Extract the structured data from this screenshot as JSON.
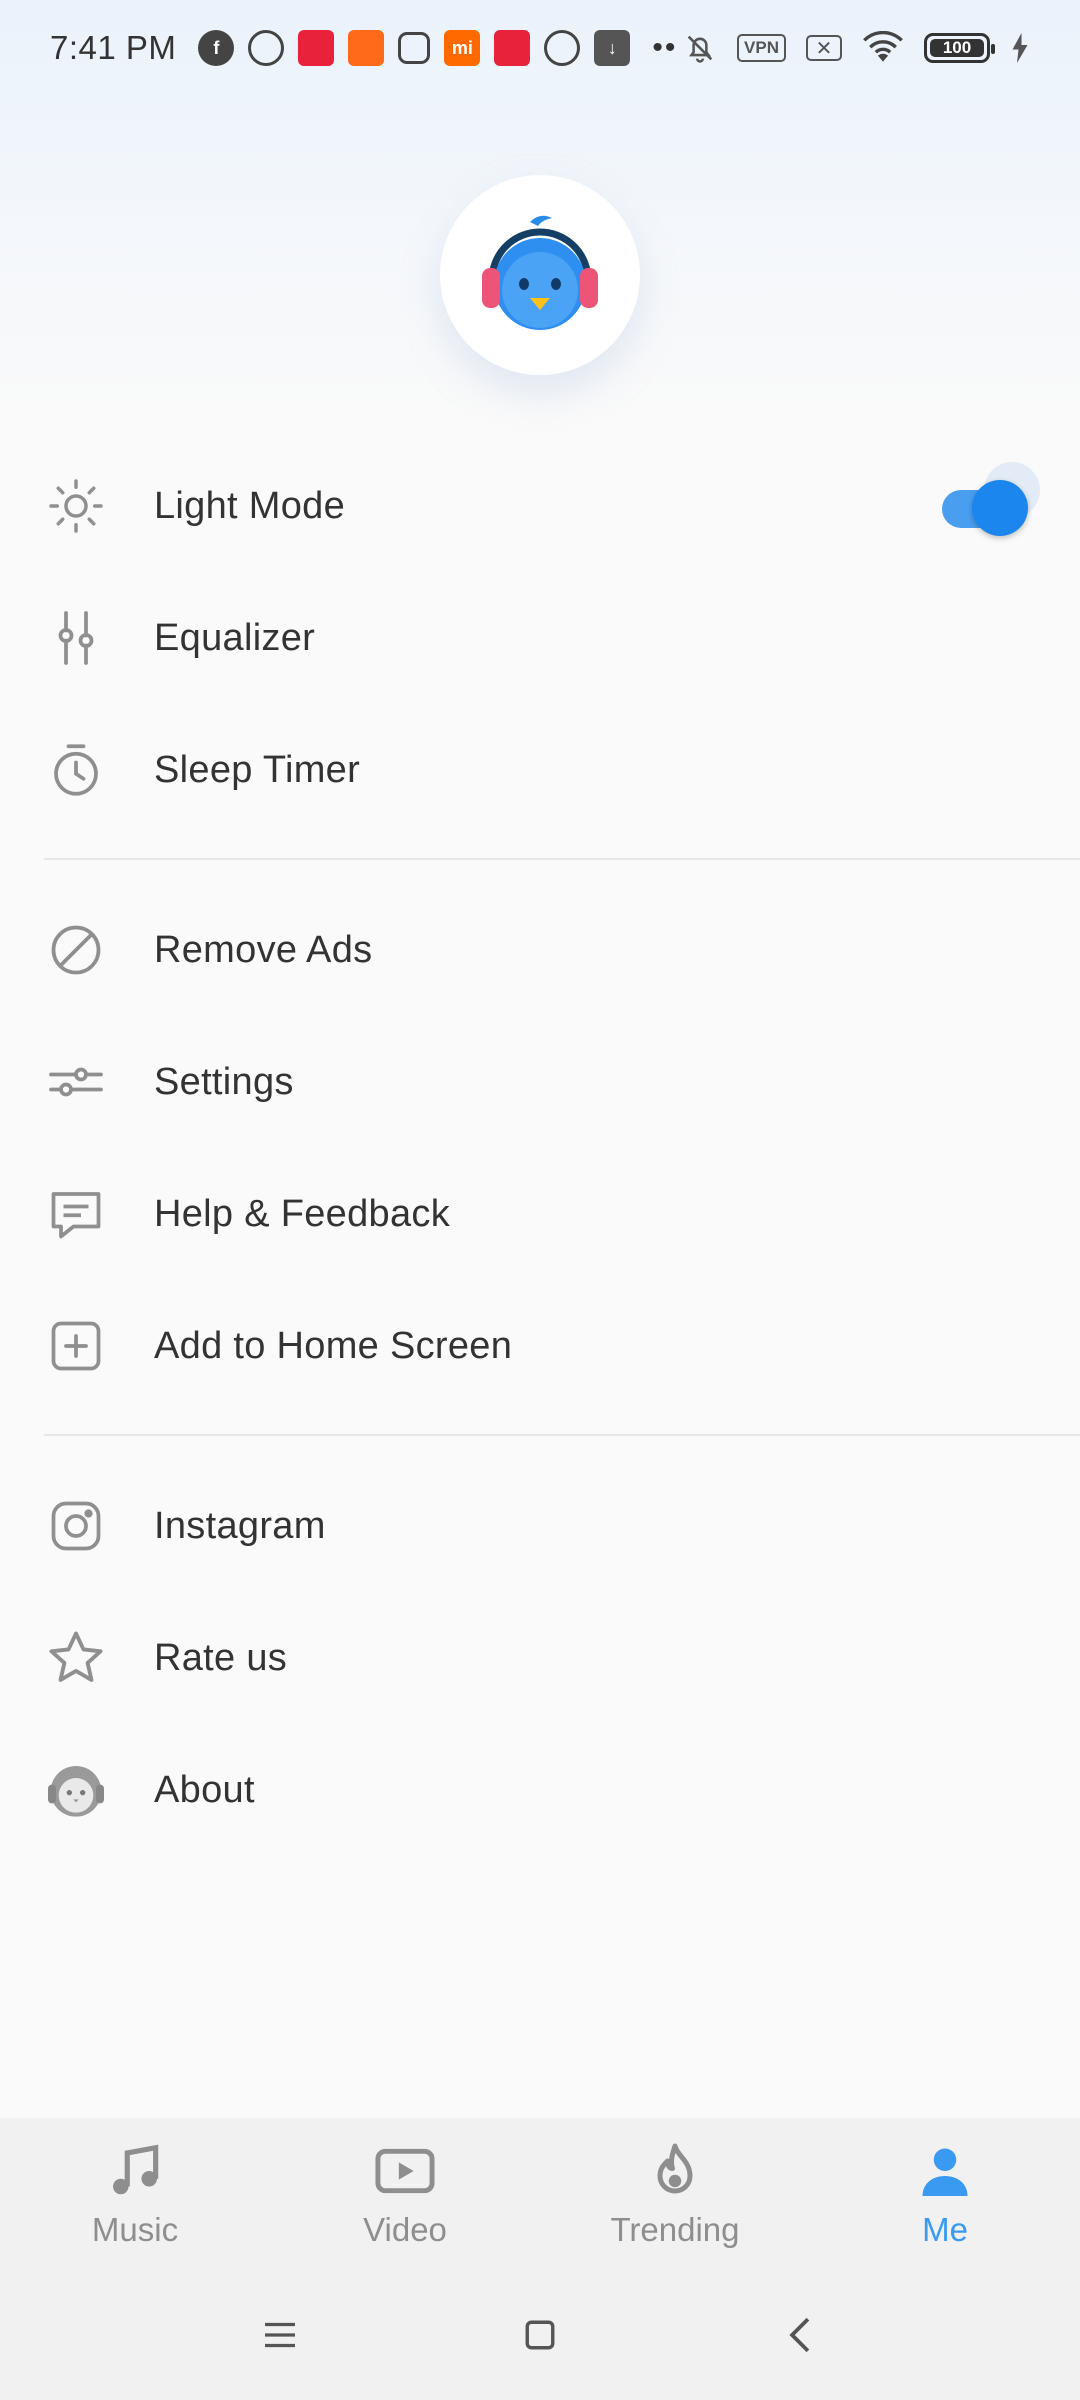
{
  "status_bar": {
    "time": "7:41 PM",
    "vpn": "VPN",
    "battery": "100"
  },
  "menu": {
    "group1": [
      {
        "label": "Light Mode",
        "icon": "sun-icon"
      },
      {
        "label": "Equalizer",
        "icon": "equalizer-icon"
      },
      {
        "label": "Sleep Timer",
        "icon": "timer-icon"
      }
    ],
    "group2": [
      {
        "label": "Remove Ads",
        "icon": "block-icon"
      },
      {
        "label": "Settings",
        "icon": "sliders-icon"
      },
      {
        "label": "Help & Feedback",
        "icon": "chat-icon"
      },
      {
        "label": "Add to Home Screen",
        "icon": "plus-box-icon"
      }
    ],
    "group3": [
      {
        "label": "Instagram",
        "icon": "instagram-icon"
      },
      {
        "label": "Rate us",
        "icon": "star-icon"
      },
      {
        "label": "About",
        "icon": "app-face-icon"
      }
    ],
    "light_mode_on": true
  },
  "bottom_nav": [
    {
      "label": "Music",
      "icon": "music-note-icon",
      "active": false
    },
    {
      "label": "Video",
      "icon": "video-play-icon",
      "active": false
    },
    {
      "label": "Trending",
      "icon": "flame-icon",
      "active": false
    },
    {
      "label": "Me",
      "icon": "person-icon",
      "active": true
    }
  ],
  "colors": {
    "accent": "#3a9af2",
    "toggle_on": "#1a86ee"
  }
}
